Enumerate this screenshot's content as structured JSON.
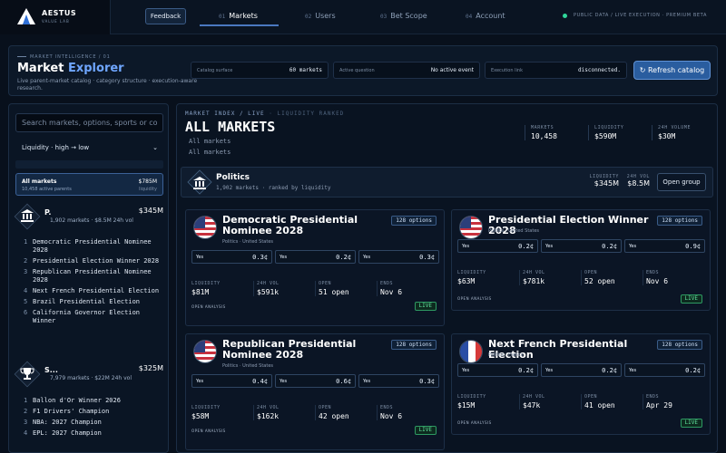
{
  "brand": {
    "name": "AESTUS",
    "sub": "VALUE LAB"
  },
  "nav": {
    "feedback": "Feedback",
    "tabs": [
      {
        "num": "01",
        "label": "Markets"
      },
      {
        "num": "02",
        "label": "Users"
      },
      {
        "num": "03",
        "label": "Bet Scope"
      },
      {
        "num": "04",
        "label": "Account"
      }
    ],
    "status": "PUBLIC DATA / LIVE EXECUTION · PREMIUM BETA"
  },
  "header": {
    "eyebrow": "MARKET INTELLIGENCE / 01",
    "title_main": "Market",
    "title_accent": "Explorer",
    "description": "Live parent-market catalog · category structure · execution-aware research.",
    "meta": [
      {
        "label": "Catalog surface",
        "value": "60 markets"
      },
      {
        "label": "Active question",
        "value": "No active event"
      },
      {
        "label": "Execution link",
        "value": "disconnected."
      }
    ],
    "refresh_icon": "refresh-icon",
    "refresh_label": "Refresh catalog"
  },
  "sidebar": {
    "search_placeholder": "Search markets, options, sports or co",
    "sort_label": "Liquidity · high → low",
    "all_card": {
      "title": "All markets",
      "sub": "10,458 active parents",
      "value": "$785M",
      "value_label": "liquidity"
    },
    "groups": [
      {
        "name": "P.",
        "icon": "bank-icon",
        "sub": "1,902 markets · $8.5M 24h vol",
        "value": "$345M",
        "items": [
          "Democratic Presidential Nominee 2028",
          "Presidential Election Winner 2028",
          "Republican Presidential Nominee 2028",
          "Next French Presidential Election",
          "Brazil Presidential Election",
          "California Governor Election Winner"
        ]
      },
      {
        "name": "S...",
        "icon": "trophy-icon",
        "sub": "7,979 markets · $22M 24h vol",
        "value": "$325M",
        "items": [
          "Ballon d'Or Winner 2026",
          "F1 Drivers' Champion",
          "NBA: 2027 Champion",
          "EPL: 2027 Champion"
        ]
      }
    ]
  },
  "main": {
    "eyebrow_a": "MARKET INDEX / LIVE",
    "eyebrow_b": "· LIQUIDITY RANKED",
    "title": "ALL MARKETS",
    "crumbs": [
      "All markets",
      "All markets"
    ],
    "stats": [
      {
        "label": "MARKETS",
        "value": "10,458"
      },
      {
        "label": "LIQUIDITY",
        "value": "$590M"
      },
      {
        "label": "24H VOLUME",
        "value": "$30M"
      }
    ],
    "group": {
      "name": "Politics",
      "sub": "1,902 markets · ranked by liquidity",
      "liq_label": "LIQUIDITY",
      "liq_value": "$345M",
      "vol_label": "24H VOL",
      "vol_value": "$8.5M",
      "open_label": "Open group"
    },
    "cards": [
      {
        "title": "Democratic Presidential Nominee 2028",
        "sub": "Politics · United States",
        "flag": "us-flag-icon",
        "options": "128 options",
        "yes": [
          {
            "label": "Yes",
            "price": "0.3¢"
          },
          {
            "label": "Yes",
            "price": "0.2¢"
          },
          {
            "label": "Yes",
            "price": "0.3¢"
          }
        ],
        "stats": [
          {
            "k": "LIQUIDITY",
            "v": "$81M"
          },
          {
            "k": "24H VOL",
            "v": "$591k"
          },
          {
            "k": "OPEN",
            "v": "51 open"
          },
          {
            "k": "ENDS",
            "v": "Nov 6"
          }
        ],
        "analysis": "OPEN ANALYSIS",
        "status": "LIVE"
      },
      {
        "title": "Presidential Election Winner 2028",
        "sub": "Politics · United States",
        "flag": "us-flag-icon",
        "options": "128 options",
        "yes": [
          {
            "label": "Yes",
            "price": "0.2¢"
          },
          {
            "label": "Yes",
            "price": "0.2¢"
          },
          {
            "label": "Yes",
            "price": "0.9¢"
          }
        ],
        "stats": [
          {
            "k": "LIQUIDITY",
            "v": "$63M"
          },
          {
            "k": "24H VOL",
            "v": "$781k"
          },
          {
            "k": "OPEN",
            "v": "52 open"
          },
          {
            "k": "ENDS",
            "v": "Nov 6"
          }
        ],
        "analysis": "OPEN ANALYSIS",
        "status": "LIVE"
      },
      {
        "title": "Republican Presidential Nominee 2028",
        "sub": "Politics · United States",
        "flag": "us-flag-icon",
        "options": "128 options",
        "yes": [
          {
            "label": "Yes",
            "price": "0.4¢"
          },
          {
            "label": "Yes",
            "price": "0.6¢"
          },
          {
            "label": "Yes",
            "price": "0.3¢"
          }
        ],
        "stats": [
          {
            "k": "LIQUIDITY",
            "v": "$58M"
          },
          {
            "k": "24H VOL",
            "v": "$162k"
          },
          {
            "k": "OPEN",
            "v": "42 open"
          },
          {
            "k": "ENDS",
            "v": "Nov 6"
          }
        ],
        "analysis": "OPEN ANALYSIS",
        "status": "LIVE"
      },
      {
        "title": "Next French Presidential Election",
        "sub": "Politics · France",
        "flag": "fr-flag-icon",
        "options": "128 options",
        "yes": [
          {
            "label": "Yes",
            "price": "0.2¢"
          },
          {
            "label": "Yes",
            "price": "0.2¢"
          },
          {
            "label": "Yes",
            "price": "0.2¢"
          }
        ],
        "stats": [
          {
            "k": "LIQUIDITY",
            "v": "$15M"
          },
          {
            "k": "24H VOL",
            "v": "$47k"
          },
          {
            "k": "OPEN",
            "v": "41 open"
          },
          {
            "k": "ENDS",
            "v": "Apr 29"
          }
        ],
        "analysis": "OPEN ANALYSIS",
        "status": "LIVE"
      }
    ]
  },
  "colors": {
    "accent": "#6fa6ff",
    "live": "#5fe39d",
    "yes": "#eaf4ff",
    "background": "#08101c"
  }
}
